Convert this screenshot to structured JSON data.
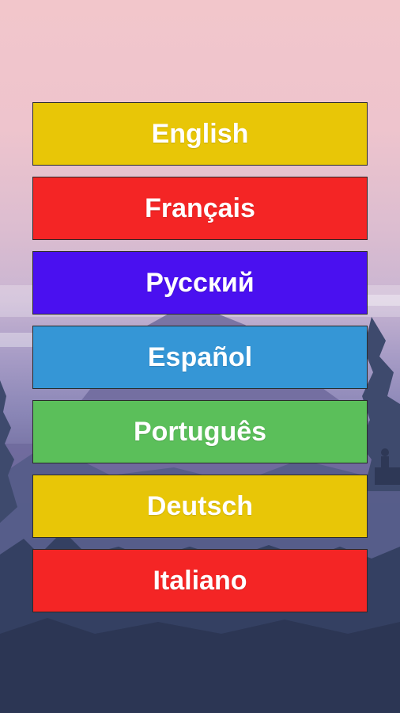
{
  "languages": [
    {
      "label": "English",
      "color": "#e8c607"
    },
    {
      "label": "Français",
      "color": "#f42525"
    },
    {
      "label": "Русский",
      "color": "#4a10f0"
    },
    {
      "label": "Español",
      "color": "#3596d6"
    },
    {
      "label": "Português",
      "color": "#5bbf5a"
    },
    {
      "label": "Deutsch",
      "color": "#e8c607"
    },
    {
      "label": "Italiano",
      "color": "#f42525"
    }
  ]
}
